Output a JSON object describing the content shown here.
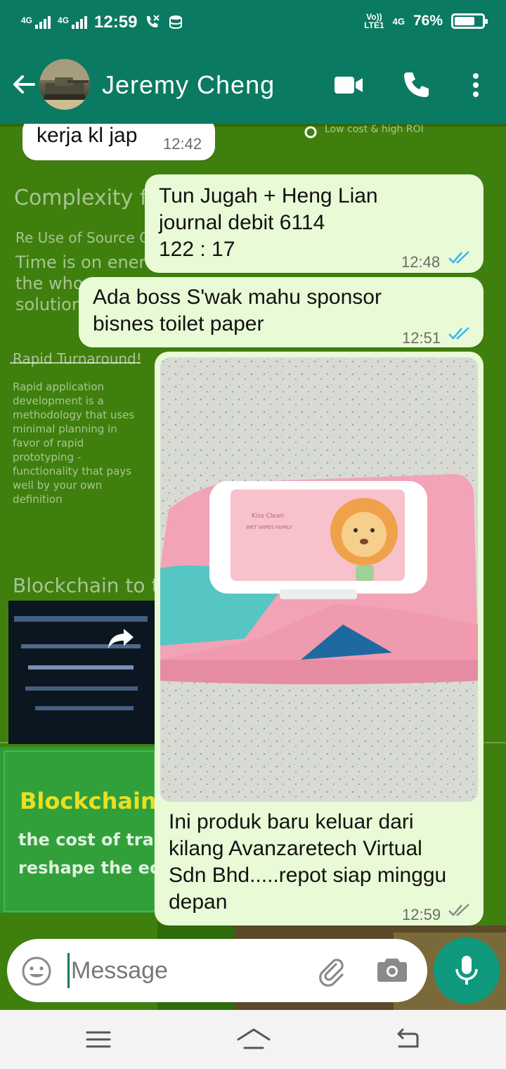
{
  "status_bar": {
    "net1": "4G",
    "net2": "4G",
    "time": "12:59",
    "volte": "Vo))",
    "lte": "LTE1",
    "net3": "4G",
    "battery": "76%",
    "battery_level": 0.76
  },
  "header": {
    "contact_name": "Jeremy Cheng"
  },
  "messages": [
    {
      "direction": "incoming",
      "text": "kerja kl jap",
      "time": "12:42"
    },
    {
      "direction": "outgoing",
      "text": "Tun Jugah + Heng Lian\njournal debit 6114\n122 : 17",
      "time": "12:48",
      "status": "read"
    },
    {
      "direction": "outgoing",
      "text": "Ada boss S'wak mahu sponsor\nbisnes toilet paper",
      "time": "12:51",
      "status": "read"
    },
    {
      "direction": "outgoing",
      "text": "Ini produk baru keluar dari\nkilang Avanzaretech Virtual\nSdn Bhd.....repot siap minggu\ndepan",
      "time": "12:59",
      "status": "delivered"
    }
  ],
  "composer": {
    "placeholder": "Message"
  },
  "colors": {
    "header": "#0b7a62",
    "outgoing_bubble": "#e8fbd6",
    "incoming_bubble": "#ffffff",
    "read_ticks": "#34b7f1",
    "delivered_ticks": "#8a8a8a",
    "mic_button": "#0f9a7e"
  },
  "icons": [
    "back-arrow-icon",
    "video-call-icon",
    "phone-icon",
    "more-options-icon",
    "emoji-icon",
    "attach-icon",
    "camera-icon",
    "mic-icon",
    "forward-icon",
    "menu-icon",
    "home-icon",
    "back-icon"
  ]
}
